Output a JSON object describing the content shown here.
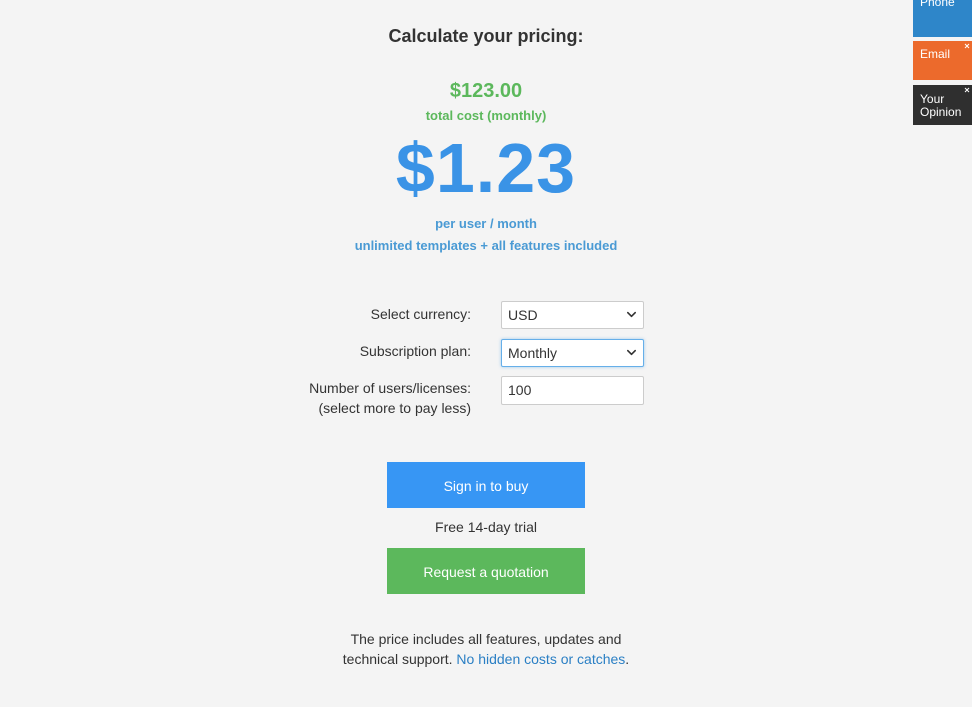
{
  "heading": "Calculate your pricing:",
  "total": {
    "amount": "$123.00",
    "label": "total cost (monthly)"
  },
  "per_user_price": "$1.23",
  "per_user_label": "per user / month",
  "features_note": "unlimited templates + all features included",
  "form": {
    "currency_label": "Select currency:",
    "currency_value": "USD",
    "plan_label": "Subscription plan:",
    "plan_value": "Monthly",
    "users_label_line1": "Number of users/licenses:",
    "users_label_line2": "(select more to pay less)",
    "users_value": "100"
  },
  "buttons": {
    "sign_in": "Sign in to buy",
    "quotation": "Request a quotation"
  },
  "trial_note": "Free 14-day trial",
  "footer": {
    "line1": "The price includes all features, updates and",
    "line2_prefix": "technical support.",
    "line2_link": "No hidden costs or catches",
    "line2_suffix": "."
  },
  "side_tabs": {
    "phone": "Phone",
    "email": "Email",
    "opinion_line1": "Your",
    "opinion_line2": "Opinion"
  },
  "colors": {
    "green": "#5cb85c",
    "blue_price": "#3a93e6",
    "blue_button": "#3796f4",
    "link": "#2a7fc4",
    "tab_phone": "#2e86c9",
    "tab_email": "#ec6a2c",
    "tab_opinion": "#2f2f2f"
  },
  "icons": {
    "dropdown": "chevron-down-icon",
    "tab_close": "close-icon"
  }
}
